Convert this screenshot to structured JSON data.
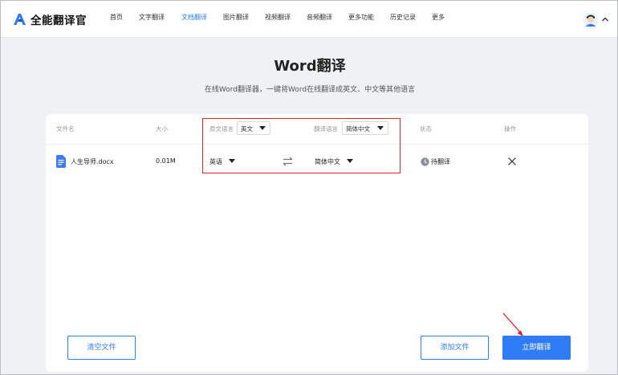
{
  "app": {
    "name": "全能翻译官",
    "accent": "#2f7cf6",
    "highlight": "#d8262b"
  },
  "nav": {
    "items": [
      {
        "label": "首页",
        "active": false
      },
      {
        "label": "文字翻译",
        "active": false
      },
      {
        "label": "文档翻译",
        "active": true
      },
      {
        "label": "图片翻译",
        "active": false
      },
      {
        "label": "视频翻译",
        "active": false
      },
      {
        "label": "音频翻译",
        "active": false
      },
      {
        "label": "更多功能",
        "active": false
      },
      {
        "label": "历史记录",
        "active": false
      },
      {
        "label": "更多",
        "active": false
      }
    ]
  },
  "page": {
    "title": "Word翻译",
    "subtitle": "在线Word翻译器，一键将Word在线翻译成英文、中文等其他语言"
  },
  "table": {
    "headers": {
      "filename": "文件名",
      "size": "大小",
      "source_lang": "原文语言",
      "source_lang_value": "英文",
      "target_lang": "翻译语言",
      "target_lang_value": "简体中文",
      "status": "状态",
      "action": "操作"
    },
    "rows": [
      {
        "filename": "人生导师.docx",
        "size": "0.01M",
        "source_lang": "英语",
        "target_lang": "简体中文",
        "status": "待翻译"
      }
    ]
  },
  "buttons": {
    "clear": "清空文件",
    "add": "添加文件",
    "translate": "立即翻译"
  }
}
